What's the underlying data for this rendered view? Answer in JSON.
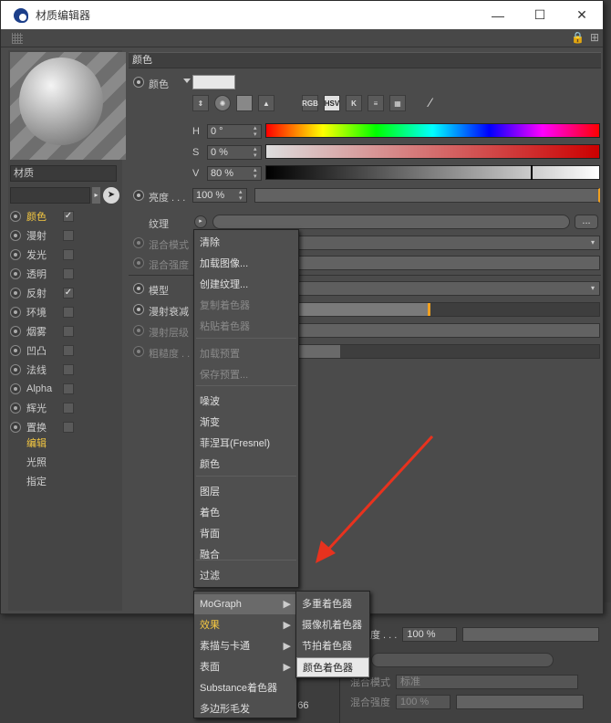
{
  "window": {
    "title": "材质编辑器",
    "controls": {
      "min": "—",
      "max": "☐",
      "close": "✕"
    }
  },
  "left": {
    "material_name": "材质",
    "channels": [
      {
        "label": "颜色",
        "checked": true,
        "active": true
      },
      {
        "label": "漫射",
        "checked": false
      },
      {
        "label": "发光",
        "checked": false
      },
      {
        "label": "透明",
        "checked": false
      },
      {
        "label": "反射",
        "checked": true
      },
      {
        "label": "环境",
        "checked": false
      },
      {
        "label": "烟雾",
        "checked": false
      },
      {
        "label": "凹凸",
        "checked": false
      },
      {
        "label": "法线",
        "checked": false
      },
      {
        "label": "Alpha",
        "checked": false
      },
      {
        "label": "辉光",
        "checked": false
      },
      {
        "label": "置换",
        "checked": false
      }
    ],
    "extra": [
      {
        "label": "编辑",
        "active": true
      },
      {
        "label": "光照"
      },
      {
        "label": "指定"
      }
    ]
  },
  "color_section": {
    "header": "颜色",
    "color_label": "颜色",
    "icons": [
      "RGB",
      "HSV",
      "K"
    ],
    "h": {
      "label": "H",
      "value": "0 °"
    },
    "s": {
      "label": "S",
      "value": "0 %"
    },
    "v": {
      "label": "V",
      "value": "80 %"
    },
    "brightness_label": "亮度 . . .",
    "brightness_value": "100 %",
    "texture_label": "纹理",
    "texture_btn": "...",
    "blend_mode_label": "混合模式",
    "blend_strength_label": "混合强度",
    "model_label": "模型",
    "diffuse_falloff_label": "漫射衰减",
    "diffuse_level_label": "漫射层级",
    "roughness_label": "粗糙度 . . ."
  },
  "context_menu": {
    "items": [
      {
        "label": "清除"
      },
      {
        "label": "加载图像..."
      },
      {
        "label": "创建纹理..."
      },
      {
        "label": "复制着色器",
        "disabled": true
      },
      {
        "label": "粘贴着色器",
        "disabled": true
      },
      {
        "label": "加载预置",
        "disabled": true
      },
      {
        "label": "保存预置...",
        "disabled": true
      },
      {
        "label": "噪波"
      },
      {
        "label": "渐变"
      },
      {
        "label": "菲涅耳(Fresnel)"
      },
      {
        "label": "颜色"
      },
      {
        "label": "图层"
      },
      {
        "label": "着色"
      },
      {
        "label": "背面"
      },
      {
        "label": "融合"
      },
      {
        "label": "过滤"
      },
      {
        "label": "MoGraph"
      },
      {
        "label": "效果"
      },
      {
        "label": "素描与卡通"
      },
      {
        "label": "表面"
      },
      {
        "label": "Substance着色器"
      },
      {
        "label": "多边形毛发"
      }
    ]
  },
  "submenu": {
    "items": [
      {
        "label": "多重着色器"
      },
      {
        "label": "摄像机着色器"
      },
      {
        "label": "节拍着色器"
      },
      {
        "label": "颜色着色器"
      }
    ]
  },
  "background": {
    "pct1": "100 %",
    "texture_label": "理",
    "blend_mode_label": "混合模式",
    "blend_mode_value": "标准",
    "blend_strength_label": "混合强度",
    "blend_strength_value": "100 %",
    "stat": "顶 : 466",
    "degree_label": "度 . . ."
  },
  "colors": {
    "accent": "#f5c842",
    "arrow": "#e8321e",
    "highlight_orange": "#f0a020"
  }
}
